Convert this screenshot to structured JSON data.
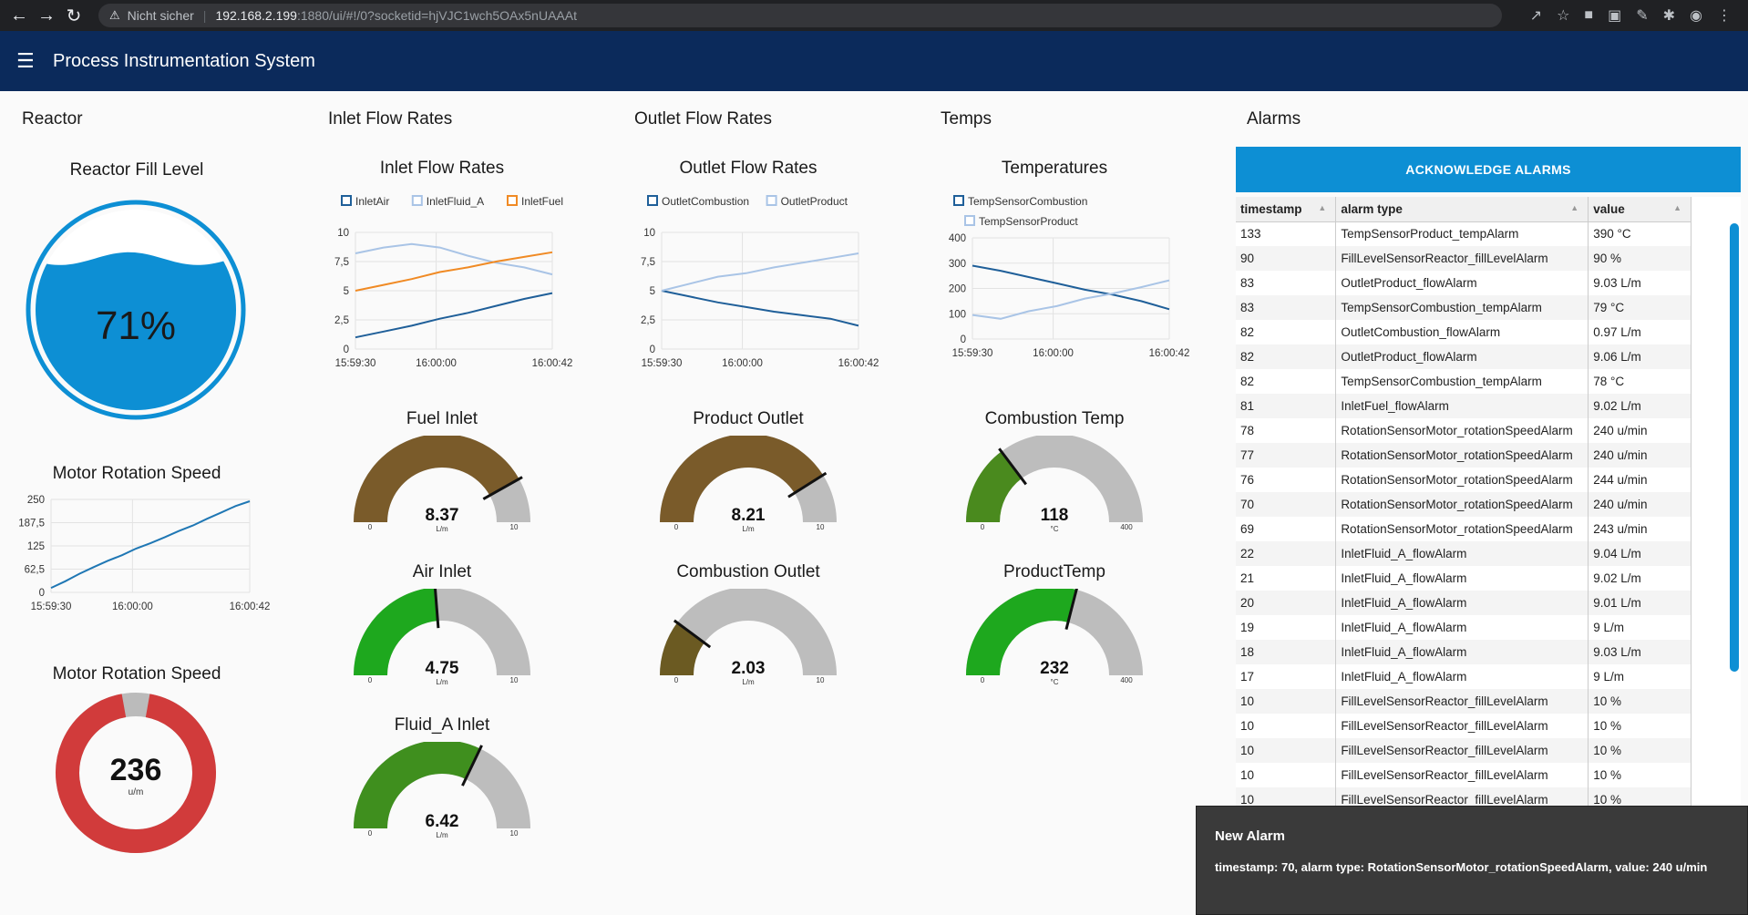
{
  "browser": {
    "security": "Nicht sicher",
    "host": "192.168.2.199",
    "rest": ":1880/ui/#!/0?socketid=hjVJC1wch5OAx5nUAAAt"
  },
  "app": {
    "title": "Process Instrumentation System"
  },
  "groups": {
    "reactor": "Reactor",
    "inlet": "Inlet Flow Rates",
    "outlet": "Outlet Flow Rates",
    "temps": "Temps",
    "alarms": "Alarms"
  },
  "reactor": {
    "fill_title": "Reactor Fill Level",
    "fill_value": "71%",
    "fill_level": 0.71,
    "speed_chart_title": "Motor Rotation Speed",
    "donut_title": "Motor Rotation Speed",
    "donut_value": "236",
    "donut_unit": "u/m",
    "donut_fraction": 0.944
  },
  "chart_data": [
    {
      "type": "line",
      "title": "Motor Rotation Speed",
      "xlabels": [
        "15:59:30",
        "16:00:00",
        "16:00:42"
      ],
      "ylim": [
        0,
        250
      ],
      "yticks": [
        "0",
        "62,5",
        "125",
        "187,5",
        "250"
      ],
      "series": [
        {
          "color": "#1f77b4",
          "x": [
            0,
            3,
            6,
            9,
            12,
            15,
            18,
            21,
            24,
            27,
            30,
            33,
            36,
            39,
            42
          ],
          "values": [
            12,
            30,
            50,
            68,
            85,
            100,
            118,
            132,
            148,
            165,
            180,
            198,
            215,
            232,
            245
          ]
        }
      ]
    },
    {
      "type": "line",
      "title": "Inlet Flow Rates",
      "xlabels": [
        "15:59:30",
        "16:00:00",
        "16:00:42"
      ],
      "ylim": [
        0,
        10
      ],
      "yticks": [
        "0",
        "2,5",
        "5",
        "7,5",
        "10"
      ],
      "legend": [
        "InletAir",
        "InletFluid_A",
        "InletFuel"
      ],
      "series": [
        {
          "name": "InletAir",
          "color": "#1f5f99",
          "x": [
            0,
            6,
            12,
            18,
            24,
            30,
            36,
            42
          ],
          "values": [
            1.0,
            1.5,
            2.0,
            2.6,
            3.1,
            3.7,
            4.3,
            4.8
          ]
        },
        {
          "name": "InletFluid_A",
          "color": "#a9c4e6",
          "x": [
            0,
            6,
            12,
            18,
            24,
            30,
            36,
            42
          ],
          "values": [
            8.2,
            8.7,
            9.0,
            8.7,
            8.0,
            7.4,
            7.0,
            6.4
          ]
        },
        {
          "name": "InletFuel",
          "color": "#f08a24",
          "x": [
            0,
            6,
            12,
            18,
            24,
            30,
            36,
            42
          ],
          "values": [
            5.0,
            5.5,
            6.0,
            6.6,
            7.0,
            7.5,
            7.9,
            8.3
          ]
        }
      ]
    },
    {
      "type": "line",
      "title": "Outlet Flow Rates",
      "xlabels": [
        "15:59:30",
        "16:00:00",
        "16:00:42"
      ],
      "ylim": [
        0,
        10
      ],
      "yticks": [
        "0",
        "2,5",
        "5",
        "7,5",
        "10"
      ],
      "legend": [
        "OutletCombustion",
        "OutletProduct"
      ],
      "series": [
        {
          "name": "OutletCombustion",
          "color": "#1f5f99",
          "x": [
            0,
            6,
            12,
            18,
            24,
            30,
            36,
            42
          ],
          "values": [
            5.0,
            4.5,
            4.0,
            3.6,
            3.2,
            2.9,
            2.6,
            2.0
          ]
        },
        {
          "name": "OutletProduct",
          "color": "#a9c4e6",
          "x": [
            0,
            6,
            12,
            18,
            24,
            30,
            36,
            42
          ],
          "values": [
            5.0,
            5.6,
            6.2,
            6.5,
            7.0,
            7.4,
            7.8,
            8.2
          ]
        }
      ]
    },
    {
      "type": "line",
      "title": "Temperatures",
      "xlabels": [
        "15:59:30",
        "16:00:00",
        "16:00:42"
      ],
      "ylim": [
        0,
        400
      ],
      "yticks": [
        "0",
        "100",
        "200",
        "300",
        "400"
      ],
      "legend": [
        "TempSensorCombustion",
        "TempSensorProduct"
      ],
      "series": [
        {
          "name": "TempSensorCombustion",
          "color": "#1f5f99",
          "x": [
            0,
            6,
            12,
            18,
            24,
            30,
            36,
            42
          ],
          "values": [
            290,
            270,
            245,
            220,
            195,
            175,
            150,
            118
          ]
        },
        {
          "name": "TempSensorProduct",
          "color": "#a9c4e6",
          "x": [
            0,
            6,
            12,
            18,
            24,
            30,
            36,
            42
          ],
          "values": [
            95,
            80,
            110,
            130,
            160,
            180,
            205,
            232
          ]
        }
      ]
    }
  ],
  "gauges": [
    {
      "title": "Fuel Inlet",
      "value": "8.37",
      "unit": "L/m",
      "min": "0",
      "max": "10",
      "fraction": 0.837,
      "color": "#7a5b2a"
    },
    {
      "title": "Air Inlet",
      "value": "4.75",
      "unit": "L/m",
      "min": "0",
      "max": "10",
      "fraction": 0.475,
      "color": "#1ea81e"
    },
    {
      "title": "Fluid_A Inlet",
      "value": "6.42",
      "unit": "L/m",
      "min": "0",
      "max": "10",
      "fraction": 0.642,
      "color": "#3f8f1e"
    },
    {
      "title": "Product Outlet",
      "value": "8.21",
      "unit": "L/m",
      "min": "0",
      "max": "10",
      "fraction": 0.821,
      "color": "#7a5b2a"
    },
    {
      "title": "Combustion Outlet",
      "value": "2.03",
      "unit": "L/m",
      "min": "0",
      "max": "10",
      "fraction": 0.203,
      "color": "#6b5a22"
    },
    {
      "title": "Combustion Temp",
      "value": "118",
      "unit": "°C",
      "min": "0",
      "max": "400",
      "fraction": 0.295,
      "color": "#4a8a1e"
    },
    {
      "title": "ProductTemp",
      "value": "232",
      "unit": "°C",
      "min": "0",
      "max": "400",
      "fraction": 0.58,
      "color": "#1ea81e"
    }
  ],
  "alarms": {
    "ack_label": "ACKNOWLEDGE ALARMS",
    "columns": [
      "timestamp",
      "alarm type",
      "value"
    ],
    "rows": [
      [
        "133",
        "TempSensorProduct_tempAlarm",
        "390 °C"
      ],
      [
        "90",
        "FillLevelSensorReactor_fillLevelAlarm",
        "90 %"
      ],
      [
        "83",
        "OutletProduct_flowAlarm",
        "9.03 L/m"
      ],
      [
        "83",
        "TempSensorCombustion_tempAlarm",
        "79 °C"
      ],
      [
        "82",
        "OutletCombustion_flowAlarm",
        "0.97 L/m"
      ],
      [
        "82",
        "OutletProduct_flowAlarm",
        "9.06 L/m"
      ],
      [
        "82",
        "TempSensorCombustion_tempAlarm",
        "78 °C"
      ],
      [
        "81",
        "InletFuel_flowAlarm",
        "9.02 L/m"
      ],
      [
        "78",
        "RotationSensorMotor_rotationSpeedAlarm",
        "240 u/min"
      ],
      [
        "77",
        "RotationSensorMotor_rotationSpeedAlarm",
        "240 u/min"
      ],
      [
        "76",
        "RotationSensorMotor_rotationSpeedAlarm",
        "244 u/min"
      ],
      [
        "70",
        "RotationSensorMotor_rotationSpeedAlarm",
        "240 u/min"
      ],
      [
        "69",
        "RotationSensorMotor_rotationSpeedAlarm",
        "243 u/min"
      ],
      [
        "22",
        "InletFluid_A_flowAlarm",
        "9.04 L/m"
      ],
      [
        "21",
        "InletFluid_A_flowAlarm",
        "9.02 L/m"
      ],
      [
        "20",
        "InletFluid_A_flowAlarm",
        "9.01 L/m"
      ],
      [
        "19",
        "InletFluid_A_flowAlarm",
        "9 L/m"
      ],
      [
        "18",
        "InletFluid_A_flowAlarm",
        "9.03 L/m"
      ],
      [
        "17",
        "InletFluid_A_flowAlarm",
        "9 L/m"
      ],
      [
        "10",
        "FillLevelSensorReactor_fillLevelAlarm",
        "10 %"
      ],
      [
        "10",
        "FillLevelSensorReactor_fillLevelAlarm",
        "10 %"
      ],
      [
        "10",
        "FillLevelSensorReactor_fillLevelAlarm",
        "10 %"
      ],
      [
        "10",
        "FillLevelSensorReactor_fillLevelAlarm",
        "10 %"
      ],
      [
        "10",
        "FillLevelSensorReactor_fillLevelAlarm",
        "10 %"
      ]
    ]
  },
  "toast": {
    "title": "New Alarm",
    "body": "timestamp: 70, alarm type: RotationSensorMotor_rotationSpeedAlarm, value: 240 u/min"
  },
  "colors": {
    "appbar": "#0b2a5b",
    "accent": "#0d8fd4",
    "donut": "#d13b3b"
  }
}
